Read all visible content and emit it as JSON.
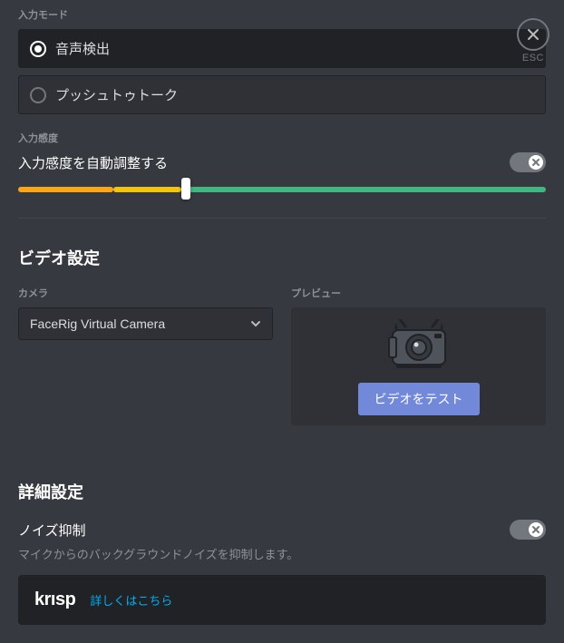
{
  "close": {
    "label": "ESC"
  },
  "input_mode": {
    "label": "入力モード",
    "options": [
      {
        "label": "音声検出",
        "selected": true
      },
      {
        "label": "プッシュトゥトーク",
        "selected": false
      }
    ]
  },
  "input_sensitivity": {
    "label": "入力感度",
    "auto_label": "入力感度を自動調整する",
    "auto_enabled": true,
    "slider": {
      "left_pct": 0,
      "split_pct": 18,
      "handle_pct": 31,
      "right_pct": 100
    }
  },
  "video": {
    "title": "ビデオ設定",
    "camera_label": "カメラ",
    "camera_value": "FaceRig Virtual Camera",
    "preview_label": "プレビュー",
    "test_button": "ビデオをテスト"
  },
  "advanced": {
    "title": "詳細設定",
    "noise": {
      "label": "ノイズ抑制",
      "desc": "マイクからのバックグラウンドノイズを抑制します。",
      "enabled": true
    },
    "krisp": {
      "logo": "krısp",
      "link": "詳しくはこちら"
    }
  }
}
